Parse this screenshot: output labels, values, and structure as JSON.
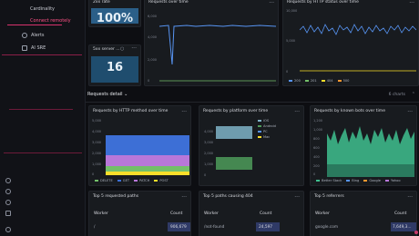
{
  "sidebar": {
    "items": [
      {
        "label": "Cardinality"
      },
      {
        "label": "Connect remotely"
      },
      {
        "label": "Alerts"
      },
      {
        "label": "AI SRE"
      }
    ]
  },
  "panels": {
    "rate2xx": {
      "title": "2xx rate",
      "value": "100%"
    },
    "rate5xx": {
      "title": "5xx server ...",
      "value": "16"
    },
    "requests_over_time": {
      "title": "Requests over time",
      "ticks": [
        "6,000",
        "4,000",
        "2,000",
        "0"
      ]
    },
    "status_over_time": {
      "title": "Requests by HTTP status over time",
      "ticks": [
        "10,000",
        "5,000",
        "0"
      ],
      "legend": [
        "200",
        "201",
        "404",
        "500"
      ]
    },
    "method_over_time": {
      "title": "Requests by HTTP method over time",
      "ticks": [
        "5,000",
        "4,000",
        "3,000",
        "2,000",
        "1,000",
        "0"
      ],
      "legend": [
        "DELETE",
        "GET",
        "PATCH",
        "POST"
      ]
    },
    "platform_over_time": {
      "title": "Requests by platform over time",
      "ticks": [
        "4,000",
        "3,000",
        "2,000",
        "1,000",
        "0"
      ],
      "legend": [
        "iOS",
        "Android",
        "PC",
        "Mac"
      ]
    },
    "bots_over_time": {
      "title": "Requests by known bots over time",
      "ticks": [
        "1,200",
        "1,000",
        "800",
        "600",
        "400",
        "200",
        "0"
      ],
      "legend": [
        "Better Stack",
        "Bing",
        "Google",
        "Yahoo"
      ]
    },
    "top_paths": {
      "title": "Top 5 requested paths",
      "col1": "Worker",
      "col2": "Count",
      "row_label": "/",
      "row_count": "906,679"
    },
    "paths_404": {
      "title": "Top 5 paths causing 404",
      "col1": "Worker",
      "col2": "Count",
      "row_label": "/not-found",
      "row_count": "24,597"
    },
    "referrers": {
      "title": "Top 5 referrers",
      "col1": "Worker",
      "col2": "Count",
      "row_label": "google.com",
      "row_count": "7,649,3..."
    }
  },
  "row": {
    "title": "Requests detail",
    "chevron": "⌄",
    "right": "6 charts",
    "collapse": "⌃"
  },
  "menu_glyph": "···",
  "colors": {
    "accent_pink": "#ff5286",
    "stat_blue": "#2b5f88",
    "green": "#73bf69",
    "blue": "#5794f2",
    "yellow": "#fade2a",
    "purple": "#b877d9",
    "teal": "#4ec9b0"
  }
}
